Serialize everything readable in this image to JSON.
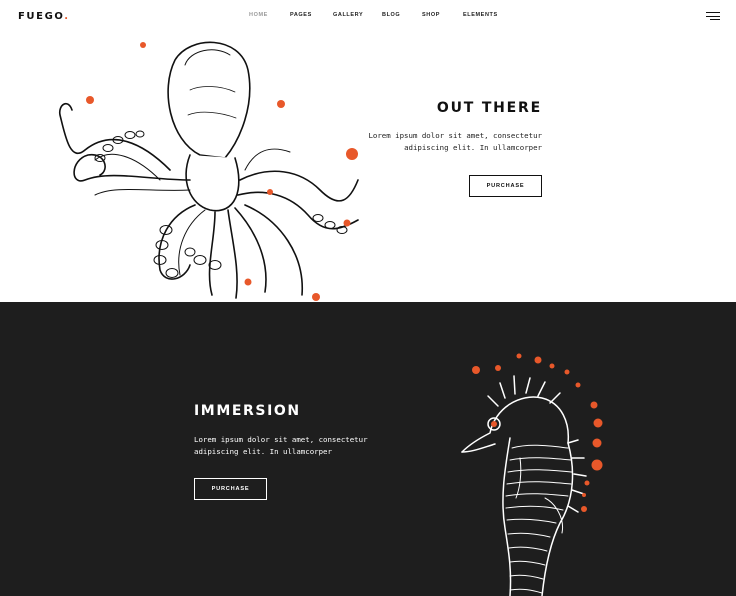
{
  "header": {
    "logo": "FUEGO",
    "logo_dot": ".",
    "nav": [
      "HOME",
      "PAGES",
      "GALLERY",
      "BLOG",
      "SHOP",
      "ELEMENTS"
    ],
    "active_nav": "HOME"
  },
  "hero": {
    "title": "OUT THERE",
    "text": "Lorem ipsum dolor sit amet, consectetur adipiscing elit. In ullamcorper",
    "button_label": "PURCHASE",
    "illustration_icon": "octopus-illustration"
  },
  "dark_section": {
    "title": "IMMERSION",
    "text": "Lorem ipsum dolor sit amet, consectetur adipiscing elit. In ullamcorper",
    "button_label": "PURCHASE",
    "illustration_icon": "seahorse-illustration"
  },
  "colors": {
    "accent": "#e8582a",
    "dark_background": "#1e1e1e",
    "light_background": "#ffffff",
    "text": "#111111"
  }
}
